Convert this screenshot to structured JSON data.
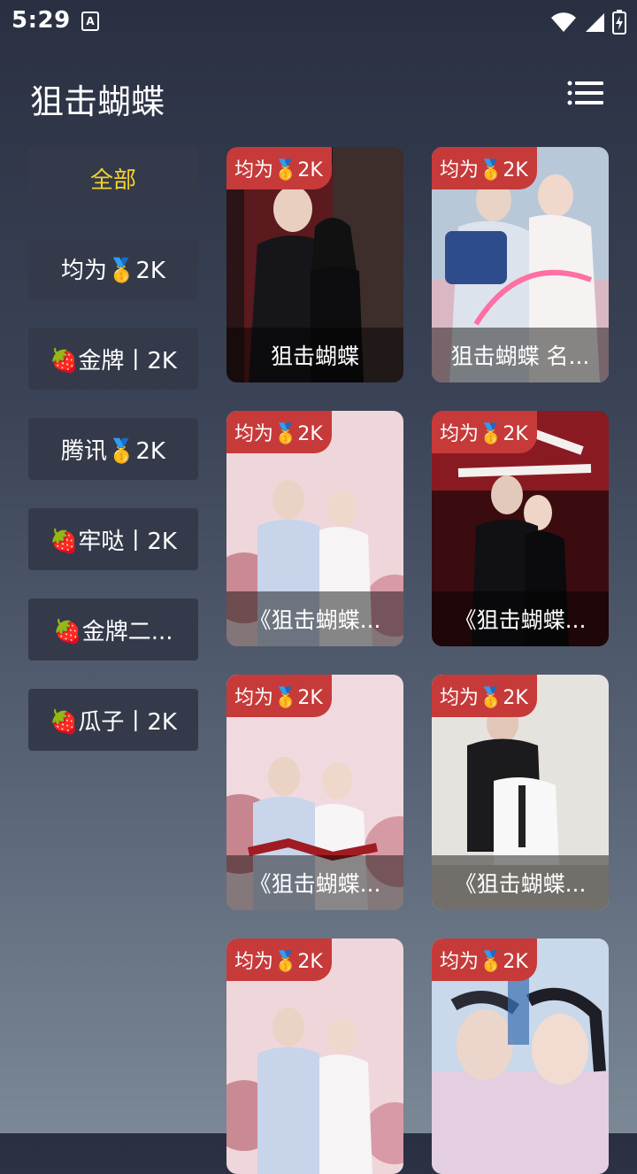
{
  "status": {
    "time": "5:29",
    "notif": "A"
  },
  "header": {
    "title": "狙击蝴蝶"
  },
  "sidebar": {
    "items": [
      {
        "label": "全部"
      },
      {
        "label": "均为🥇2K"
      },
      {
        "label": "🍓金牌丨2K"
      },
      {
        "label": "腾讯🥇2K"
      },
      {
        "label": "🍓牢哒丨2K"
      },
      {
        "label": "🍓金牌二..."
      },
      {
        "label": "🍓瓜子丨2K"
      }
    ]
  },
  "cards": [
    {
      "badge": "均为🥇2K",
      "title": "狙击蝴蝶"
    },
    {
      "badge": "均为🥇2K",
      "title": "狙击蝴蝶 名..."
    },
    {
      "badge": "均为🥇2K",
      "title": "《狙击蝴蝶..."
    },
    {
      "badge": "均为🥇2K",
      "title": "《狙击蝴蝶..."
    },
    {
      "badge": "均为🥇2K",
      "title": "《狙击蝴蝶..."
    },
    {
      "badge": "均为🥇2K",
      "title": "《狙击蝴蝶..."
    },
    {
      "badge": "均为🥇2K",
      "title": ""
    },
    {
      "badge": "均为🥇2K",
      "title": ""
    }
  ],
  "colors": {
    "active": "#f2d22e",
    "badge": "#c73a3a",
    "sidebar_item": "#343a4a"
  }
}
